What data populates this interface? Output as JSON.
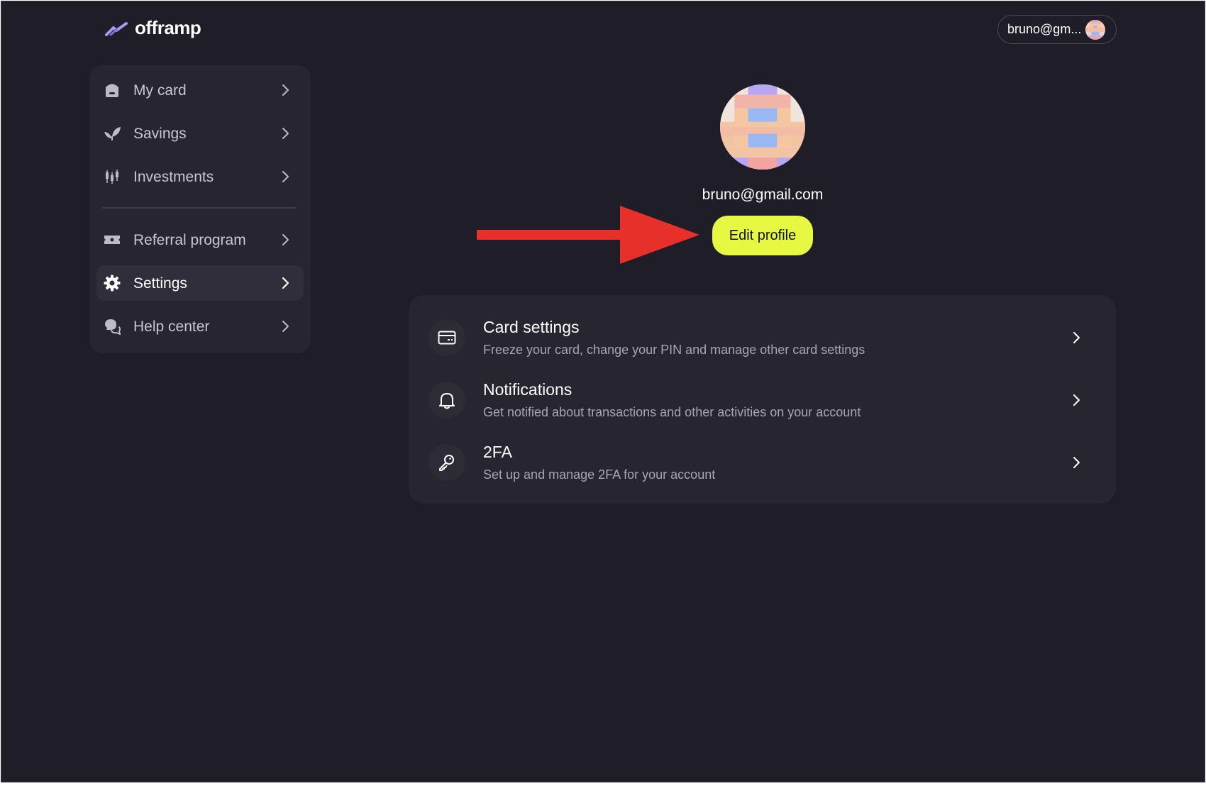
{
  "header": {
    "logo_text": "offramp",
    "user_short": "bruno@gm..."
  },
  "sidebar": {
    "items": [
      {
        "label": "My card",
        "icon": "card-holder-icon"
      },
      {
        "label": "Savings",
        "icon": "leaf-icon"
      },
      {
        "label": "Investments",
        "icon": "candlestick-icon"
      },
      {
        "label": "Referral program",
        "icon": "ticket-icon"
      },
      {
        "label": "Settings",
        "icon": "gear-icon",
        "active": true
      },
      {
        "label": "Help center",
        "icon": "chat-bubbles-icon"
      }
    ]
  },
  "profile": {
    "email": "bruno@gmail.com",
    "edit_label": "Edit profile"
  },
  "settings": {
    "rows": [
      {
        "title": "Card settings",
        "description": "Freeze your card, change your PIN and manage other card settings",
        "icon": "credit-card-icon"
      },
      {
        "title": "Notifications",
        "description": "Get notified about transactions and other activities on your account",
        "icon": "bell-icon"
      },
      {
        "title": "2FA",
        "description": "Set up and manage 2FA for your account",
        "icon": "key-icon"
      }
    ]
  },
  "colors": {
    "background": "#1f1d27",
    "panel": "#272530",
    "accent": "#e7f843",
    "annotation_arrow": "#e8302a"
  }
}
